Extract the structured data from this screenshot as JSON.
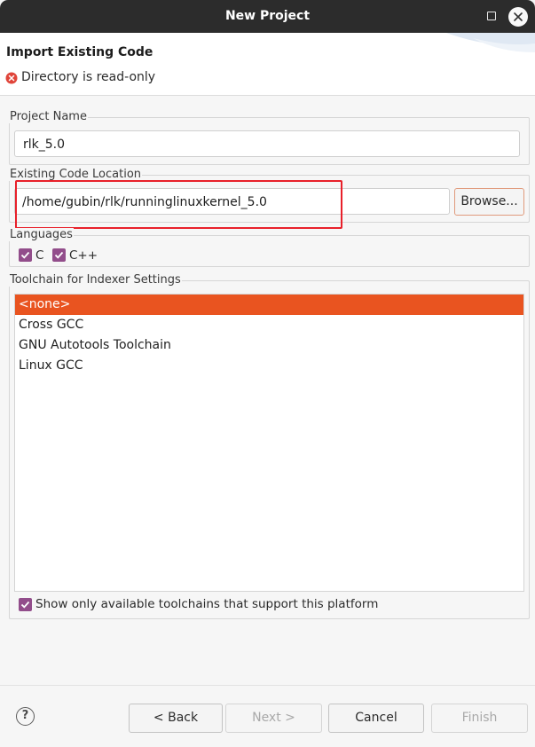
{
  "window": {
    "title": "New Project"
  },
  "header": {
    "page_title": "Import Existing Code",
    "error_message": "Directory is read-only"
  },
  "project_name": {
    "legend": "Project Name",
    "value": "rlk_5.0"
  },
  "code_location": {
    "legend": "Existing Code Location",
    "value": "/home/gubin/rlk/runninglinuxkernel_5.0",
    "browse_label": "Browse..."
  },
  "languages": {
    "legend": "Languages",
    "items": [
      {
        "label": "C",
        "checked": true
      },
      {
        "label": "C++",
        "checked": true
      }
    ]
  },
  "toolchain": {
    "legend": "Toolchain for Indexer Settings",
    "items": [
      "<none>",
      "Cross GCC",
      "GNU Autotools Toolchain",
      "Linux GCC"
    ],
    "selected_index": 0,
    "show_available_label": "Show only available toolchains that support this platform",
    "show_available_checked": true
  },
  "footer": {
    "help_glyph": "?",
    "back_label": "< Back",
    "next_label": "Next >",
    "cancel_label": "Cancel",
    "finish_label": "Finish"
  },
  "colors": {
    "selection": "#e95420",
    "checkbox": "#924d8b",
    "error": "#e0453a",
    "highlight_box": "#e8202a",
    "titlebar": "#2c2c2c"
  }
}
